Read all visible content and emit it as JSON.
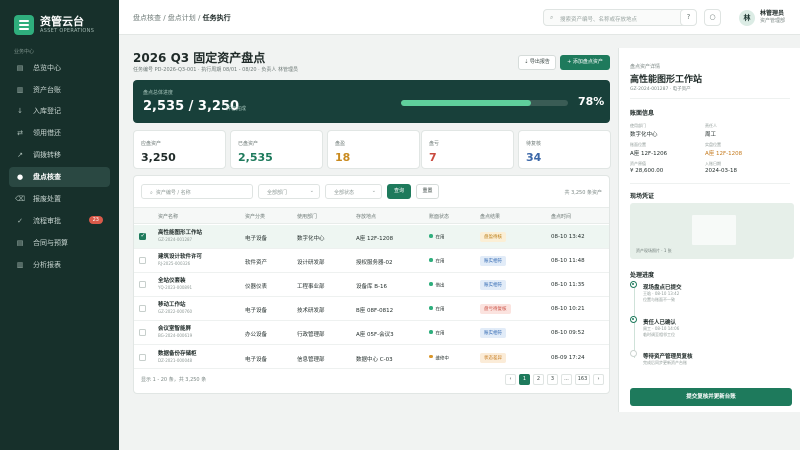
{
  "app": {
    "name": "资管云台",
    "sub": "ASSET OPERATIONS"
  },
  "nav": {
    "section": "业务中心",
    "items": [
      {
        "icon": "▤",
        "label": "总览中心"
      },
      {
        "icon": "▥",
        "label": "资产台账"
      },
      {
        "icon": "↓",
        "label": "入库登记"
      },
      {
        "icon": "⇄",
        "label": "领用借还"
      },
      {
        "icon": "↗",
        "label": "调拨转移"
      },
      {
        "icon": "●",
        "label": "盘点核查"
      },
      {
        "icon": "⌫",
        "label": "报废处置"
      },
      {
        "icon": "✓",
        "label": "流程审批",
        "badge": "23"
      },
      {
        "icon": "▤",
        "label": "合同与预算"
      },
      {
        "icon": "▥",
        "label": "分析报表"
      }
    ]
  },
  "topbar": {
    "crumb1": "盘点核查 / 盘点计划 / ",
    "crumb2": "任务执行",
    "search_placeholder": "搜索资产编号、名称或存放地点",
    "help_icon": "?",
    "bell_icon": "○",
    "user_initial": "林",
    "user_name": "林管理员",
    "user_role": "资产管理部"
  },
  "page": {
    "title": "2026 Q3 固定资产盘点",
    "subtitle": "任务编号 PD-2026-Q3-001 · 执行周期 08/01 - 08/20 · 负责人 林管理员",
    "export_label": "⇣ 导出报告",
    "add_label": "+ 添加盘点资产"
  },
  "progress": {
    "label": "盘点总体进度",
    "main": "2,535 / 3,250",
    "sub": "件已完成",
    "fraction": 0.78,
    "pct": "78%"
  },
  "stats": [
    {
      "label": "应盘资产",
      "value": "3,250",
      "color": "#1f2a28"
    },
    {
      "label": "已盘资产",
      "value": "2,535",
      "color": "#1e7a5c"
    },
    {
      "label": "盘盈",
      "value": "18",
      "color": "#c98a1e"
    },
    {
      "label": "盘亏",
      "value": "7",
      "color": "#c94a3e"
    },
    {
      "label": "待复核",
      "value": "34",
      "color": "#3b67a8"
    }
  ],
  "filters": {
    "search": "资产编号 / 名称",
    "dept": "全部部门",
    "status": "全部状态",
    "query": "查询",
    "reset": "重置",
    "count": "共 3,250 条资产"
  },
  "columns": [
    "资产名称",
    "资产分类",
    "使用部门",
    "存放地点",
    "账面状态",
    "盘点结果",
    "盘点时间"
  ],
  "rows": [
    {
      "name": "高性能图形工作站",
      "code": "GZ-2024-001287",
      "category": "电子设备",
      "dept": "数字化中心",
      "loc": "A座 12F-1208",
      "status": "在用",
      "status_color": "#2fae7d",
      "result": "盘盈待核",
      "result_fg": "#b87b12",
      "result_bg": "#fbefd6",
      "time": "08-10 13:42",
      "checked": true
    },
    {
      "name": "建筑设计软件许可",
      "code": "RJ-2025-000326",
      "category": "软件资产",
      "dept": "设计研发部",
      "loc": "授权服务器-02",
      "status": "在用",
      "status_color": "#2fae7d",
      "result": "账实相符",
      "result_fg": "#2f67b1",
      "result_bg": "#e2ecf8",
      "time": "08-10 11:48",
      "checked": false
    },
    {
      "name": "全站仪套装",
      "code": "YQ-2023-000891",
      "category": "仪器仪表",
      "dept": "工程事业部",
      "loc": "设备库 B-16",
      "status": "借出",
      "status_color": "#2fae7d",
      "result": "账实相符",
      "result_fg": "#2f67b1",
      "result_bg": "#e2ecf8",
      "time": "08-10 11:35",
      "checked": false
    },
    {
      "name": "移动工作站",
      "code": "GZ-2022-000760",
      "category": "电子设备",
      "dept": "技术研发部",
      "loc": "B座 08F-0812",
      "status": "在用",
      "status_color": "#2fae7d",
      "result": "盘亏待复核",
      "result_fg": "#c94a3e",
      "result_bg": "#fbe3df",
      "time": "08-10 10:21",
      "checked": false
    },
    {
      "name": "会议室智能屏",
      "code": "BG-2024-000619",
      "category": "办公设备",
      "dept": "行政管理部",
      "loc": "A座 05F-会议3",
      "status": "在用",
      "status_color": "#2fae7d",
      "result": "账实相符",
      "result_fg": "#2f67b1",
      "result_bg": "#e2ecf8",
      "time": "08-10 09:52",
      "checked": false
    },
    {
      "name": "数据备份存储柜",
      "code": "DZ-2021-000048",
      "category": "电子设备",
      "dept": "信息管理部",
      "loc": "数据中心 C-03",
      "status": "维修中",
      "status_color": "#d9962a",
      "result": "状态差异",
      "result_fg": "#c4781a",
      "result_bg": "#fbecd8",
      "time": "08-09 17:24",
      "checked": false
    }
  ],
  "pager": {
    "info": "显示 1 - 20 条，共 3,250 条",
    "prev": "‹",
    "pages": [
      "1",
      "2",
      "3",
      "...",
      "163"
    ],
    "next": "›"
  },
  "panel": {
    "kicker": "盘点资产详情",
    "title": "高性能图形工作站",
    "sub": "GZ-2024-001287 · 电子资产",
    "sec_archive": "账面信息",
    "fields": [
      {
        "label": "使用部门",
        "value": "数字化中心",
        "color": "#1f2a28"
      },
      {
        "label": "责任人",
        "value": "周工",
        "color": "#1f2a28"
      },
      {
        "label": "账面位置",
        "value": "A座 12F-1206",
        "color": "#1f2a28"
      },
      {
        "label": "实盘位置",
        "value": "A座 12F-1208",
        "color": "#c4781a"
      },
      {
        "label": "资产原值",
        "value": "¥ 28,600.00",
        "color": "#1f2a28"
      },
      {
        "label": "入账日期",
        "value": "2024-03-18",
        "color": "#1f2a28"
      }
    ],
    "sec_photo": "现场凭证",
    "photo_cap": "资产现场照片 · 1 张",
    "sec_flow": "处理进度",
    "steps": [
      {
        "title": "现场盘点已提交",
        "desc1": "王晗 · 08-10 13:42",
        "desc2": "位置与账面不一致"
      },
      {
        "title": "责任人已确认",
        "desc1": "周工 · 08-10 14:06",
        "desc2": "临时调至相邻工位"
      },
      {
        "title": "等待资产管理员复核",
        "desc1": "完成后同步更新资产台账",
        "desc2": ""
      }
    ],
    "button": "提交复核并更新台账"
  }
}
